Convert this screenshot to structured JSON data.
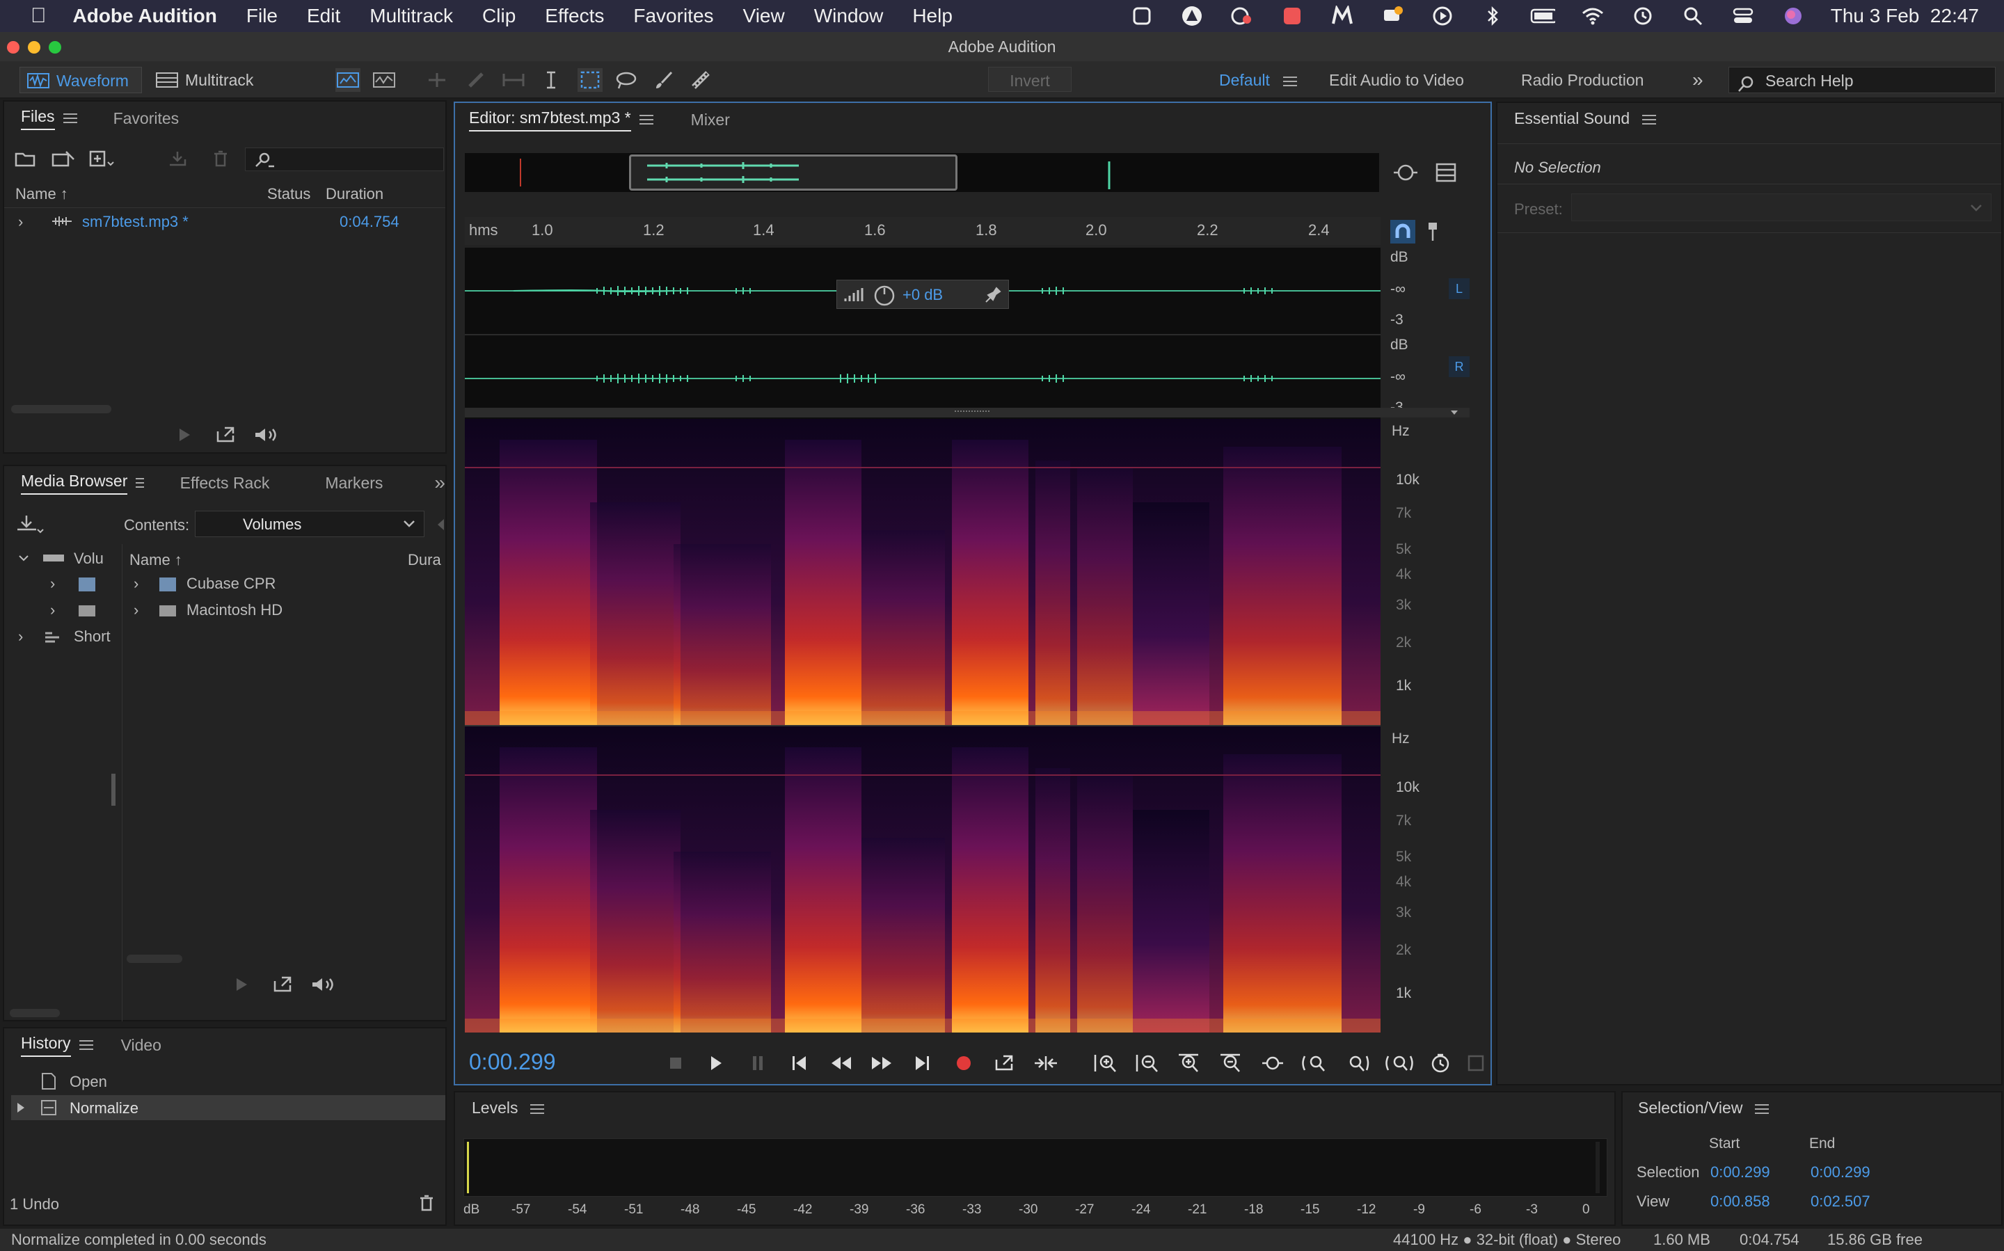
{
  "menubar": {
    "app": "Adobe Audition",
    "items": [
      "File",
      "Edit",
      "Multitrack",
      "Clip",
      "Effects",
      "Favorites",
      "View",
      "Window",
      "Help"
    ],
    "clock": "Thu 3 Feb  22:47"
  },
  "window_title": "Adobe Audition",
  "toolbar": {
    "waveform": "Waveform",
    "multitrack": "Multitrack",
    "invert": "Invert",
    "workspaces": [
      "Default",
      "Edit Audio to Video",
      "Radio Production"
    ],
    "search_placeholder": "Search Help"
  },
  "files_panel": {
    "tabs": [
      "Files",
      "Favorites"
    ],
    "col_name": "Name",
    "col_status": "Status",
    "col_duration": "Duration",
    "file": {
      "name": "sm7btest.mp3 *",
      "duration": "0:04.754"
    }
  },
  "media_panel": {
    "tabs": [
      "Media Browser",
      "Effects Rack",
      "Markers"
    ],
    "contents_label": "Contents:",
    "contents_value": "Volumes",
    "tree": [
      "Volu",
      "Short"
    ],
    "col_name": "Name",
    "col_dura": "Dura",
    "items": [
      "Cubase CPR",
      "Macintosh HD"
    ]
  },
  "history_panel": {
    "tabs": [
      "History",
      "Video"
    ],
    "items": [
      "Open",
      "Normalize"
    ],
    "undo": "1 Undo"
  },
  "editor": {
    "tab": "Editor: sm7btest.mp3 *",
    "mixer": "Mixer",
    "ruler_unit": "hms",
    "ruler": [
      "1.0",
      "1.2",
      "1.4",
      "1.6",
      "1.8",
      "2.0",
      "2.2",
      "2.4"
    ],
    "db_unit": "dB",
    "db_ticks": [
      "-∞",
      "-3"
    ],
    "channel_L": "L",
    "channel_R": "R",
    "hud_gain": "+0 dB",
    "hz_unit": "Hz",
    "freq_ticks": [
      "10k",
      "7k",
      "5k",
      "4k",
      "3k",
      "2k",
      "1k"
    ],
    "time": "0:00.299"
  },
  "essential_sound": {
    "title": "Essential Sound",
    "no_selection": "No Selection",
    "preset": "Preset:"
  },
  "levels": {
    "title": "Levels",
    "ticks": [
      "dB",
      "-57",
      "-54",
      "-51",
      "-48",
      "-45",
      "-42",
      "-39",
      "-36",
      "-33",
      "-30",
      "-27",
      "-24",
      "-21",
      "-18",
      "-15",
      "-12",
      "-9",
      "-6",
      "-3",
      "0"
    ]
  },
  "selection_view": {
    "title": "Selection/View",
    "start": "Start",
    "end": "End",
    "selection_label": "Selection",
    "selection_start": "0:00.299",
    "selection_end": "0:00.299",
    "view_label": "View",
    "view_start": "0:00.858",
    "view_end": "0:02.507"
  },
  "status": {
    "message": "Normalize completed in 0.00 seconds",
    "format": "44100 Hz ● 32-bit (float) ● Stereo",
    "size": "1.60 MB",
    "duration": "0:04.754",
    "free": "15.86 GB free"
  },
  "colors": {
    "accent": "#4c9be8",
    "record": "#e23a3a",
    "wave": "#4fd6a6"
  }
}
